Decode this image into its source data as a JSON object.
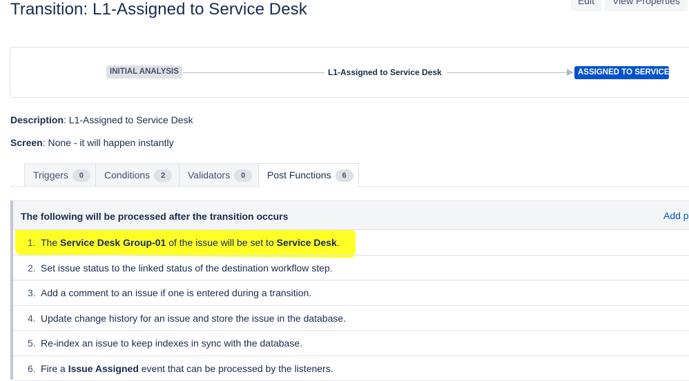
{
  "page": {
    "title": "Transition: L1-Assigned to Service Desk",
    "edit_label": "Edit",
    "properties_label": "View Properties"
  },
  "diagram": {
    "source_status": "INITIAL ANALYSIS",
    "transition_name": "L1-Assigned to Service Desk",
    "target_status": "ASSIGNED TO SERVICE..."
  },
  "meta": {
    "description_label": "Description",
    "description_value": ": L1-Assigned to Service Desk",
    "screen_label": "Screen",
    "screen_value": ": None - it will happen instantly"
  },
  "tabs": [
    {
      "label": "Triggers",
      "count": "0"
    },
    {
      "label": "Conditions",
      "count": "2"
    },
    {
      "label": "Validators",
      "count": "0"
    },
    {
      "label": "Post Functions",
      "count": "6"
    }
  ],
  "post_functions": {
    "header": "The following will be processed after the transition occurs",
    "add_label": "Add p",
    "items": [
      {
        "num": "1.",
        "a": "The ",
        "b": "Service Desk Group-01",
        "c": " of the issue will be set to ",
        "d": "Service Desk",
        "e": "."
      },
      {
        "num": "2.",
        "a": "Set issue status to the linked status of the destination workflow step."
      },
      {
        "num": "3.",
        "a": "Add a comment to an issue if one is entered during a transition."
      },
      {
        "num": "4.",
        "a": "Update change history for an issue and store the issue in the database."
      },
      {
        "num": "5.",
        "a": "Re-index an issue to keep indexes in sync with the database."
      },
      {
        "num": "6.",
        "a": "Fire a ",
        "b": "Issue Assigned",
        "c": " event that can be processed by the listeners."
      }
    ]
  },
  "colors": {
    "highlight": "#ffff00",
    "target_status_bg": "#0052cc",
    "link": "#0052cc"
  }
}
